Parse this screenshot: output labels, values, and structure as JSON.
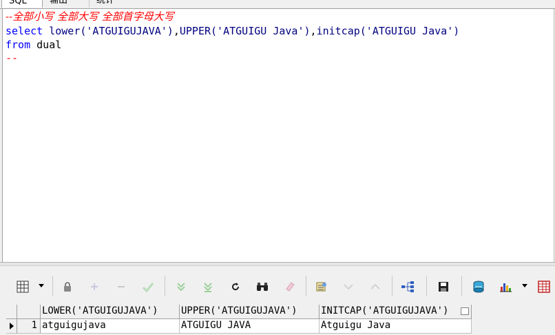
{
  "tabs": [
    "SQL",
    "输出",
    "统计"
  ],
  "editor": {
    "line1": "--全部小写 全部大写 全部首字母大写",
    "line2": {
      "select": "select ",
      "lower": "lower",
      "arg1": "('ATGUIGUJAVA')",
      "comma1": ",",
      "upper": "UPPER",
      "arg2": "('ATGUIGU Java')",
      "comma2": ",",
      "initcap": "initcap",
      "arg3": "('ATGUIGU Java')"
    },
    "line3": {
      "from": "from",
      "table": " dual"
    },
    "line4": "--"
  },
  "toolbar": {
    "icons": [
      "grid-icon",
      "lock-icon",
      "add-icon",
      "remove-icon",
      "check-icon",
      "down-double-icon",
      "down-double-icon",
      "refresh-icon",
      "binoculars-icon",
      "eraser-icon",
      "query-icon",
      "down-icon",
      "up-icon",
      "tree-icon",
      "save-icon",
      "database-icon",
      "chart-icon",
      "table-icon"
    ]
  },
  "results": {
    "columns": [
      "LOWER('ATGUIGUJAVA')",
      "UPPER('ATGUIGUJAVA')",
      "INITCAP('ATGUIGUJAVA')"
    ],
    "rows": [
      {
        "num": "1",
        "cells": [
          "atguigujava",
          "ATGUIGU JAVA",
          "Atguigu Java"
        ]
      }
    ]
  }
}
